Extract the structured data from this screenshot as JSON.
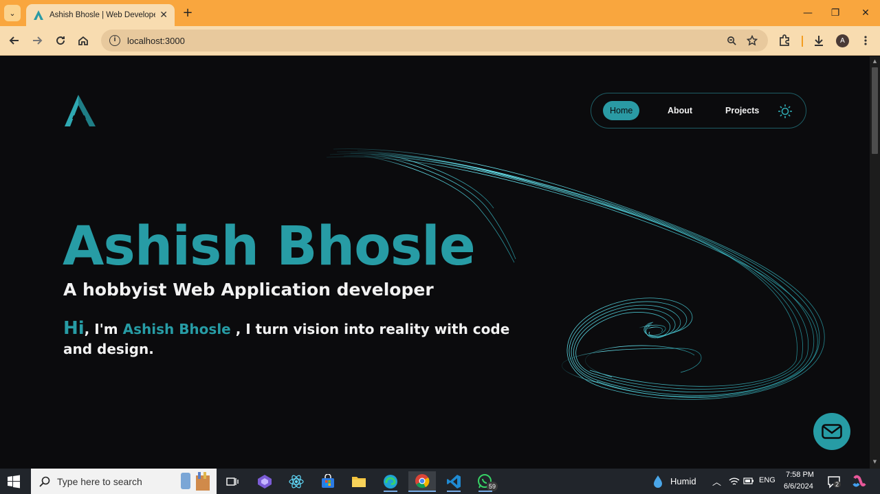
{
  "browser": {
    "tab_title": "Ashish Bhosle | Web Developer",
    "url": "localhost:3000",
    "profile_initial": "A"
  },
  "site": {
    "nav": {
      "home": "Home",
      "about": "About",
      "projects": "Projects"
    },
    "hero": {
      "name": "Ashish Bhosle",
      "subtitle": "A hobbyist Web Application developer",
      "hi": "Hi",
      "intro_before": ", I'm ",
      "intro_name": "Ashish Bhosle",
      "intro_after": " , I turn vision into reality with code and design."
    },
    "accent_color": "#279ca5"
  },
  "taskbar": {
    "search_placeholder": "Type here to search",
    "weather": "Humid",
    "language": "ENG",
    "time": "7:58 PM",
    "date": "6/6/2024",
    "whatsapp_badge": "59",
    "notifications_badge": "2"
  }
}
